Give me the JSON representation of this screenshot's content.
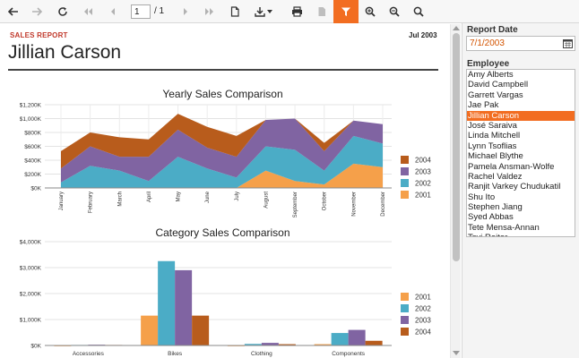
{
  "toolbar": {
    "page_value": "1",
    "page_total": "/ 1"
  },
  "report": {
    "label": "SALES REPORT",
    "date": "Jul 2003",
    "employee_name": "Jillian Carson"
  },
  "colors": {
    "accent": "#f26d21",
    "series_2001": "#f5a04a",
    "series_2002": "#4bacc6",
    "series_2003": "#8064a2",
    "series_2004": "#b85c1c"
  },
  "chart_data": [
    {
      "type": "area",
      "title": "Yearly Sales Comparison",
      "xlabel": "",
      "ylabel": "",
      "ylim": [
        0,
        1200000
      ],
      "y_ticks": [
        "$0K",
        "$200K",
        "$400K",
        "$600K",
        "$800K",
        "$1,000K",
        "$1,200K"
      ],
      "categories": [
        "January",
        "February",
        "March",
        "April",
        "May",
        "June",
        "July",
        "August",
        "September",
        "October",
        "November",
        "December"
      ],
      "stacked": true,
      "series": [
        {
          "name": "2001",
          "values": [
            0,
            0,
            0,
            0,
            0,
            0,
            0,
            250000,
            100000,
            50000,
            350000,
            300000
          ]
        },
        {
          "name": "2002",
          "values": [
            80000,
            320000,
            250000,
            100000,
            450000,
            280000,
            150000,
            350000,
            450000,
            200000,
            400000,
            340000
          ]
        },
        {
          "name": "2003",
          "values": [
            200000,
            280000,
            200000,
            350000,
            390000,
            300000,
            300000,
            380000,
            450000,
            280000,
            220000,
            280000
          ]
        },
        {
          "name": "2004",
          "values": [
            250000,
            200000,
            280000,
            250000,
            230000,
            300000,
            300000,
            0,
            0,
            120000,
            0,
            0
          ]
        }
      ],
      "legend": [
        "2004",
        "2003",
        "2002",
        "2001"
      ],
      "legend_position": "right",
      "grid": true
    },
    {
      "type": "bar",
      "title": "Category Sales Comparison",
      "xlabel": "",
      "ylabel": "",
      "ylim": [
        0,
        4000000
      ],
      "y_ticks": [
        "$0K",
        "$1,000K",
        "$2,000K",
        "$3,000K",
        "$4,000K"
      ],
      "categories": [
        "Accessories",
        "Bikes",
        "Clothing",
        "Components"
      ],
      "series": [
        {
          "name": "2001",
          "values": [
            0,
            1150000,
            0,
            50000
          ]
        },
        {
          "name": "2002",
          "values": [
            20000,
            3250000,
            60000,
            480000
          ]
        },
        {
          "name": "2003",
          "values": [
            30000,
            2900000,
            100000,
            600000
          ]
        },
        {
          "name": "2004",
          "values": [
            20000,
            1150000,
            50000,
            180000
          ]
        }
      ],
      "legend": [
        "2001",
        "2002",
        "2003",
        "2004"
      ],
      "legend_position": "right",
      "grid": true
    }
  ],
  "params": {
    "date_label": "Report Date",
    "date_value": "7/1/2003",
    "employee_label": "Employee",
    "employees": [
      "Amy Alberts",
      "David Campbell",
      "Garrett Vargas",
      "Jae Pak",
      "Jillian Carson",
      "José Saraiva",
      "Linda Mitchell",
      "Lynn Tsoflias",
      "Michael Blythe",
      "Pamela Ansman-Wolfe",
      "Rachel Valdez",
      "Ranjit Varkey Chudukatil",
      "Shu Ito",
      "Stephen Jiang",
      "Syed Abbas",
      "Tete Mensa-Annan",
      "Tsvi Reiter"
    ],
    "selected_employee": "Jillian Carson"
  }
}
